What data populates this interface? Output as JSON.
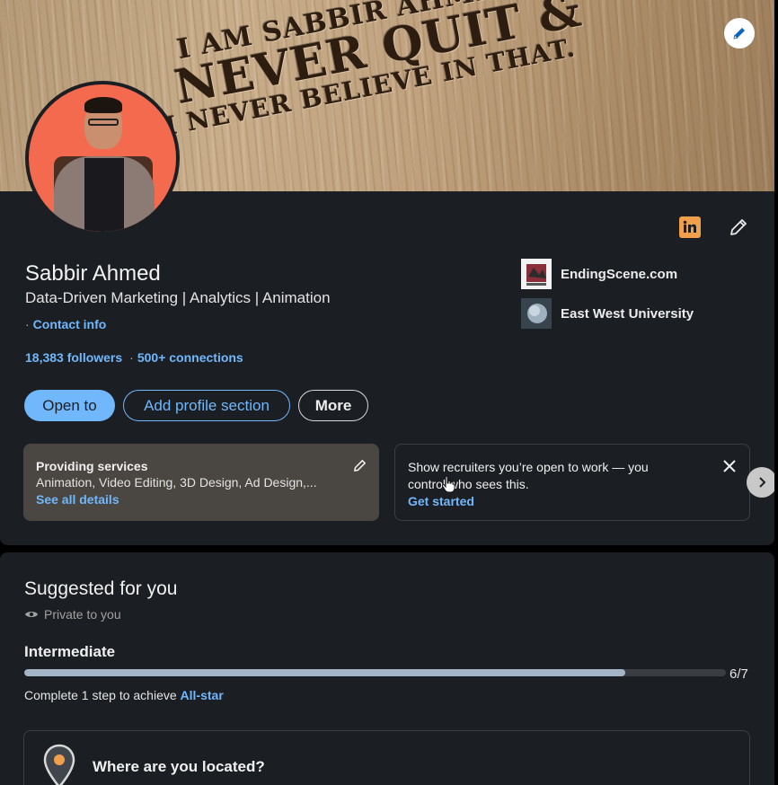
{
  "banner": {
    "line1": "I AM SABBIR AHMED",
    "line2": "NEVER QUIT &",
    "line3": "I NEVER BELIEVE IN THAT."
  },
  "profile": {
    "name": "Sabbir Ahmed",
    "headline": "Data-Driven Marketing | Analytics | Animation",
    "contact_prefix": "·",
    "contact_label": "Contact info",
    "followers": "18,383 followers",
    "connections_prefix": "·",
    "connections": "500+ connections"
  },
  "organizations": [
    {
      "name": "EndingScene.com",
      "icon": "endingscene-logo"
    },
    {
      "name": "East West University",
      "icon": "university-logo"
    }
  ],
  "actions": {
    "open_to": "Open to",
    "add_section": "Add profile section",
    "more": "More"
  },
  "services_panel": {
    "title": "Providing services",
    "text": "Animation, Video Editing, 3D Design, Ad Design,...",
    "link": "See all details"
  },
  "open_to_work_panel": {
    "text_line1": "Show recruiters you’re open to work — you",
    "text_line2": "control who sees this.",
    "link": "Get started"
  },
  "suggested": {
    "title": "Suggested for you",
    "privacy": "Private to you",
    "level": "Intermediate",
    "progress_fraction": 0.857,
    "progress_text": "6/7",
    "complete_prefix": "Complete 1 step to achieve",
    "complete_link": "All-star",
    "location_prompt": "Where are you located?"
  },
  "colors": {
    "accent_link": "#71b7fb",
    "card_bg": "#1b1f23",
    "linkedin_badge": "#f0a04b"
  }
}
